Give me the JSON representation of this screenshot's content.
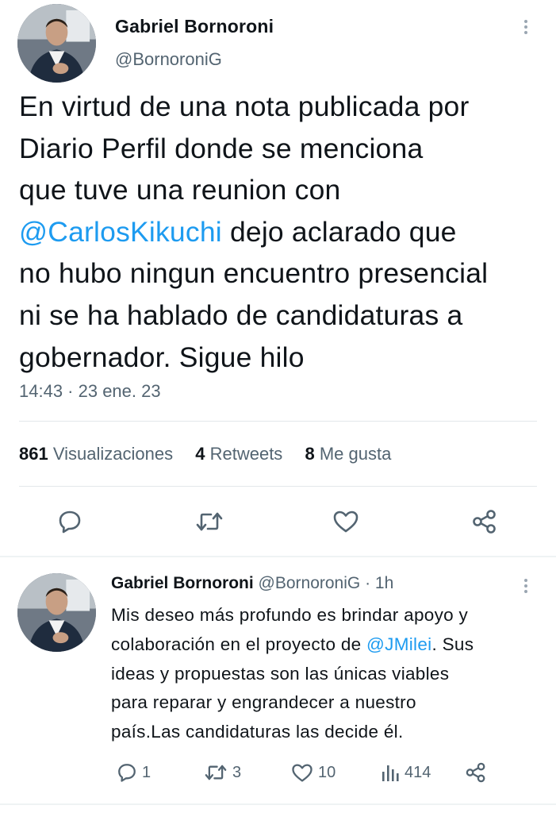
{
  "main_tweet": {
    "author_name": "Gabriel Bornoroni",
    "author_handle": "@BornoroniG",
    "text_lines": [
      "En virtud de una nota publicada por",
      "Diario Perfil donde se menciona",
      "que tuve una reunion con",
      "dejo aclarado que",
      "no hubo ningun encuentro presencial",
      "ni se ha hablado de candidaturas a",
      "gobernador. Sigue hilo"
    ],
    "mention": "@CarlosKikuchi",
    "timestamp": "14:43 · 23 ene. 23",
    "stats": {
      "views_count": "861",
      "views_label": "Visualizaciones",
      "retweets_count": "4",
      "retweets_label": "Retweets",
      "likes_count": "8",
      "likes_label": "Me gusta"
    },
    "actions": [
      "reply-icon",
      "retweet-icon",
      "like-icon",
      "share-icon"
    ]
  },
  "reply_tweet": {
    "author_name": "Gabriel Bornoroni",
    "author_handle": "@BornoroniG",
    "time_ago": "· 1h",
    "text_lines": [
      "Mis deseo más profundo es brindar apoyo y",
      "colaboración en el proyecto de",
      ". Sus",
      "ideas y propuestas son las únicas viables",
      "para reparar y engrandecer a nuestro",
      "país.Las candidaturas las decide él."
    ],
    "mention": "@JMilei",
    "counts": {
      "replies": "1",
      "retweets": "3",
      "likes": "10",
      "views": "414"
    }
  },
  "colors": {
    "accent": "#1d9bf0",
    "text": "#0f1419",
    "secondary": "#536471",
    "divider": "#e3e7ea"
  }
}
